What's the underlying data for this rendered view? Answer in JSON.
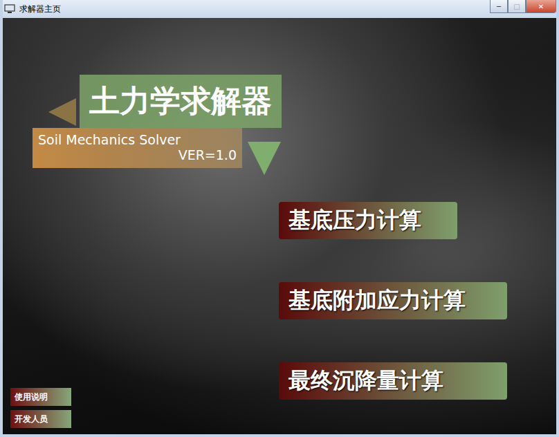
{
  "window": {
    "title": "求解器主页",
    "controls": [
      {
        "name": "minimize",
        "glyph": "─",
        "disabled": false
      },
      {
        "name": "maximize",
        "glyph": "□",
        "disabled": true
      },
      {
        "name": "close",
        "glyph": "✕",
        "disabled": false
      }
    ]
  },
  "app": {
    "title": "土力学求解器",
    "subtitle": "Soil Mechanics Solver",
    "version": "VER=1.0"
  },
  "menu": [
    {
      "label": "基底压力计算",
      "wide": false
    },
    {
      "label": "基底附加应力计算",
      "wide": true
    },
    {
      "label": "最终沉降量计算",
      "wide": true
    }
  ],
  "footer_buttons": [
    "使用说明",
    "开发人员"
  ]
}
